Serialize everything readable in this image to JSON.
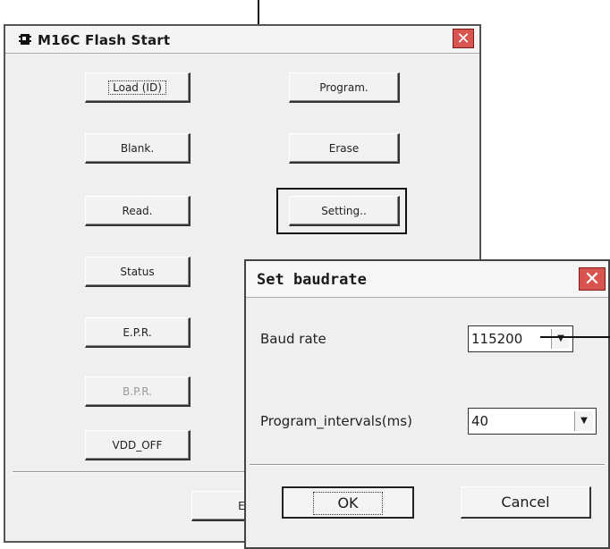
{
  "main_window": {
    "title": "M16C Flash Start",
    "close_glyph": "✕",
    "buttons_left": [
      "Load (ID)",
      "Blank.",
      "Read.",
      "Status",
      "E.P.R.",
      "B.P.R.",
      "VDD_OFF"
    ],
    "buttons_right": [
      "Program.",
      "Erase",
      "Setting.."
    ],
    "exit_label": "Ex"
  },
  "dialog": {
    "title": "Set baudrate",
    "close_glyph": "✕",
    "baud_label": "Baud rate",
    "baud_value": "115200",
    "interval_label": "Program_intervals(ms)",
    "interval_value": "40",
    "ok_label": "OK",
    "cancel_label": "Cancel"
  },
  "icons": {
    "app": "chip-icon",
    "dropdown": "dropdown-arrow-icon",
    "close": "close-icon"
  },
  "colors": {
    "close_button": "#d9534f",
    "window_bg": "#efefef"
  }
}
